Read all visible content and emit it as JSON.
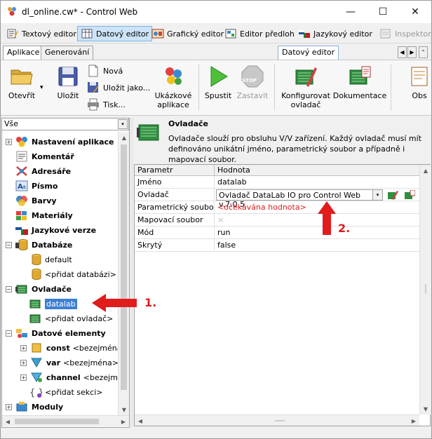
{
  "window": {
    "title": "dl_online.cw* - Control Web",
    "minimize_glyph": "—",
    "maximize_glyph": "☐",
    "close_glyph": "✕"
  },
  "toolbar": {
    "items": [
      {
        "label": "Textový editor",
        "icon": "text-editor-icon"
      },
      {
        "label": "Datový editor",
        "icon": "data-editor-icon",
        "active": true
      },
      {
        "label": "Grafický editor",
        "icon": "graphic-editor-icon"
      },
      {
        "label": "Editor předloh",
        "icon": "template-editor-icon"
      },
      {
        "label": "Jazykový editor",
        "icon": "language-editor-icon"
      },
      {
        "label": "Inspektor",
        "icon": "inspector-icon",
        "disabled": true
      }
    ]
  },
  "tabs": {
    "left": [
      "Aplikace",
      "Generování"
    ],
    "context": "Datový editor",
    "scroll_left": "◀",
    "scroll_right": "▶",
    "expand": "⌃"
  },
  "ribbon": {
    "open": "Otevřít",
    "open_arrow": "▾",
    "save": "Uložit",
    "new": "Nová",
    "save_as": "Uložit jako...",
    "print": "Tisk...",
    "samples": "Ukázkové aplikace",
    "run": "Spustit",
    "stop": "Zastavit",
    "stop_badge": "STOP",
    "configure_driver": "Konfigurovat ovladač",
    "documentation": "Dokumentace",
    "obs": "Obs"
  },
  "filter": {
    "value": "Vše",
    "arrow": "▾"
  },
  "tree": {
    "nodes": [
      {
        "label": "Nastavení aplikace",
        "bold": true,
        "expander": "+"
      },
      {
        "label": "Komentář",
        "bold": true
      },
      {
        "label": "Adresáře",
        "bold": true
      },
      {
        "label": "Písmo",
        "bold": true
      },
      {
        "label": "Barvy",
        "bold": true
      },
      {
        "label": "Materiály",
        "bold": true
      },
      {
        "label": "Jazykové verze",
        "bold": true
      },
      {
        "label": "Databáze",
        "bold": true,
        "expander": "−"
      },
      {
        "label": "default"
      },
      {
        "label": "<přidat databázi>"
      },
      {
        "label": "Ovladače",
        "bold": true,
        "expander": "−"
      },
      {
        "label": "datalab",
        "selected": true
      },
      {
        "label": "<přidat ovladač>"
      },
      {
        "label": "Datové elementy",
        "bold": true,
        "expander": "−"
      },
      {
        "label": "const",
        "suffix": "<bezejména>",
        "expander": "+"
      },
      {
        "label": "var",
        "suffix": "<bezejména>",
        "expander": "+"
      },
      {
        "label": "channel",
        "suffix": "<bezejmén",
        "expander": "+"
      },
      {
        "label": "<přidat sekci>"
      },
      {
        "label": "Moduly",
        "bold": true,
        "expander": "+"
      }
    ]
  },
  "details": {
    "title": "Ovladače",
    "description": "Ovladače slouží pro obsluhu V/V zařízení. Každý ovladač musí mít definováno unikátní jméno, parametrický soubor a případně i mapovací soubor."
  },
  "grid": {
    "headers": [
      "Parametr",
      "Hodnota"
    ],
    "rows": [
      {
        "param": "Jméno",
        "value": "datalab"
      },
      {
        "param": "Ovladač",
        "value": "Ovladač DataLab IO pro Control Web v.7.0.5",
        "dropdown": true
      },
      {
        "param": "Parametrický soubor",
        "value": "<očekávána hodnota>",
        "missing": true
      },
      {
        "param": "Mapovací soubor",
        "value": "×",
        "empty": true
      },
      {
        "param": "Mód",
        "value": "run"
      },
      {
        "param": "Skrytý",
        "value": "false"
      }
    ]
  },
  "annotations": {
    "one": "1.",
    "two": "2."
  },
  "scroll": {
    "up": "▲",
    "down": "▼",
    "left": "◀",
    "right": "▶"
  },
  "colors": {
    "selection": "#3d7fd4",
    "annotation": "#e01c1c",
    "missing_value": "#e01c1c"
  }
}
